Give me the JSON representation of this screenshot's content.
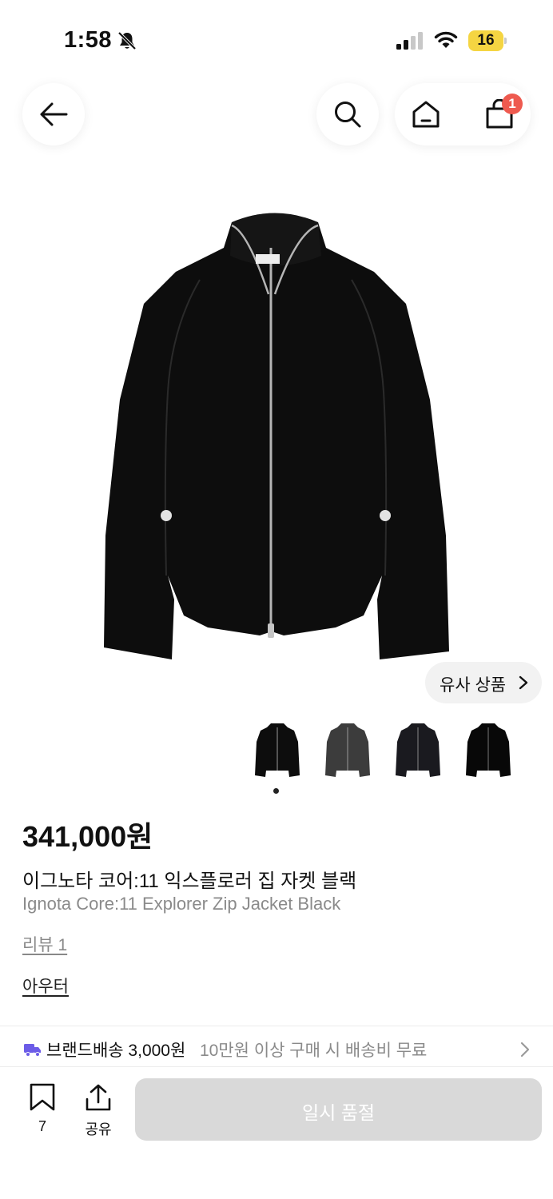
{
  "status_bar": {
    "time": "1:58",
    "battery_level": "16",
    "icons": [
      "bell-slash-icon",
      "signal-icon",
      "wifi-icon",
      "battery-icon"
    ]
  },
  "header": {
    "icons": [
      "arrow-left-icon",
      "search-icon",
      "home-icon",
      "cart-icon"
    ],
    "cart_badge": "1"
  },
  "gallery": {
    "similar_label": "유사 상품",
    "thumbnail_count": 4,
    "active_index": 0
  },
  "product": {
    "price": "341,000원",
    "name_ko": "이그노타 코어:11 익스플로러 집 자켓 블랙",
    "name_en": "Ignota Core:11 Explorer Zip Jacket Black",
    "review": "리뷰 1",
    "category": "아우터"
  },
  "shipping": {
    "brand_fee": "브랜드배송 3,000원",
    "free_condition": "10만원 이상 구매 시 배송비 무료"
  },
  "bottom_bar": {
    "bookmark_count": "7",
    "share_label": "공유",
    "soldout_label": "일시 품절"
  },
  "colors": {
    "badge": "#ee5a4f",
    "battery": "#f5d542",
    "truck": "#6c5ce7",
    "soldout_button": "#d9d9d9"
  }
}
